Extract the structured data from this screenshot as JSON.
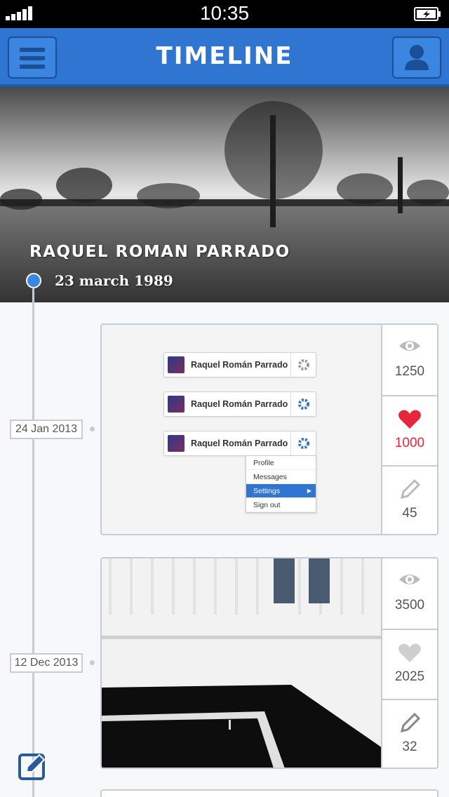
{
  "status": {
    "time": "10:35"
  },
  "nav": {
    "title": "TIMELINE",
    "menu_icon": "hamburger-icon",
    "user_icon": "user-icon"
  },
  "profile": {
    "name": "RAQUEL ROMAN PARRADO",
    "birthdate": "23 march 1989"
  },
  "posts": [
    {
      "date": "24 Jan 2013",
      "views": "1250",
      "likes": "1000",
      "comments": "45",
      "mockup": {
        "user_name": "Raquel Román Parrado",
        "menu": [
          "Profile",
          "Messages",
          "Settings",
          "Sign out"
        ],
        "active_menu": "Settings"
      }
    },
    {
      "date": "12 Dec 2013",
      "views": "3500",
      "likes": "2025",
      "comments": "32"
    }
  ],
  "colors": {
    "accent": "#2f75d1",
    "like": "#e8263a",
    "border": "#c5ccd4"
  }
}
